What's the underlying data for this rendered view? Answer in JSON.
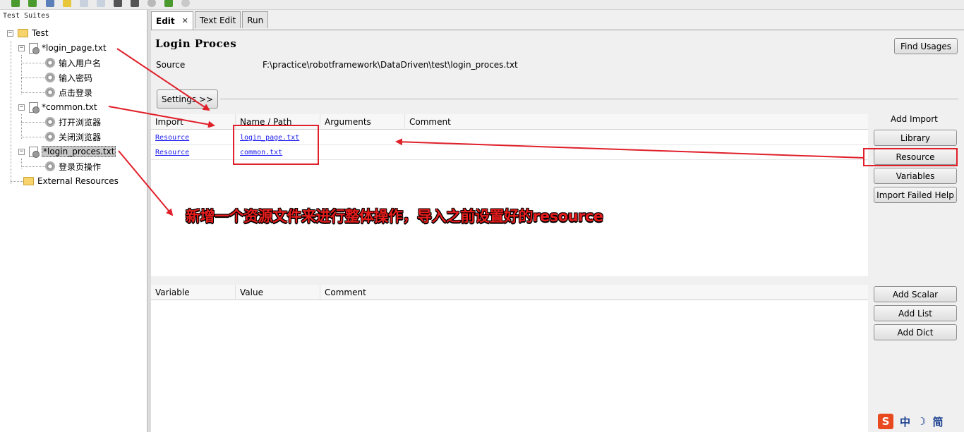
{
  "tree": {
    "title": "Test Suites",
    "root": "Test",
    "files": [
      {
        "name": "*login_page.txt",
        "keywords": [
          "输入用户名",
          "输入密码",
          "点击登录"
        ]
      },
      {
        "name": "*common.txt",
        "keywords": [
          "打开浏览器",
          "关闭浏览器"
        ]
      },
      {
        "name": "*login_proces.txt",
        "keywords": [
          "登录页操作"
        ]
      }
    ],
    "external": "External Resources"
  },
  "tabs": {
    "edit": "Edit",
    "close": "✕",
    "text_edit": "Text Edit",
    "run": "Run"
  },
  "editor": {
    "title": "Login Proces",
    "source_label": "Source",
    "source_value": "F:\\practice\\robotframework\\DataDriven\\test\\login_proces.txt",
    "find_usages": "Find Usages",
    "settings_button": "Settings >>"
  },
  "imports": {
    "headers": [
      "Import",
      "Name / Path",
      "Arguments",
      "Comment"
    ],
    "rows": [
      {
        "import": "Resource",
        "path": "login_page.txt"
      },
      {
        "import": "Resource",
        "path": "common.txt"
      }
    ]
  },
  "add_import": {
    "heading": "Add Import",
    "buttons": [
      "Library",
      "Resource",
      "Variables",
      "Import Failed Help"
    ]
  },
  "variables": {
    "headers": [
      "Variable",
      "Value",
      "Comment"
    ]
  },
  "add_variable": {
    "buttons": [
      "Add Scalar",
      "Add List",
      "Add Dict"
    ]
  },
  "annotation": "新增一个资源文件来进行整体操作，导入之前设置好的resource",
  "ime": {
    "mode": "中",
    "moon": "☽",
    "script": "简"
  },
  "colors": {
    "annotation_red": "#e51c1c",
    "link_blue": "#1a1aee",
    "ime_orange": "#e8491e"
  }
}
